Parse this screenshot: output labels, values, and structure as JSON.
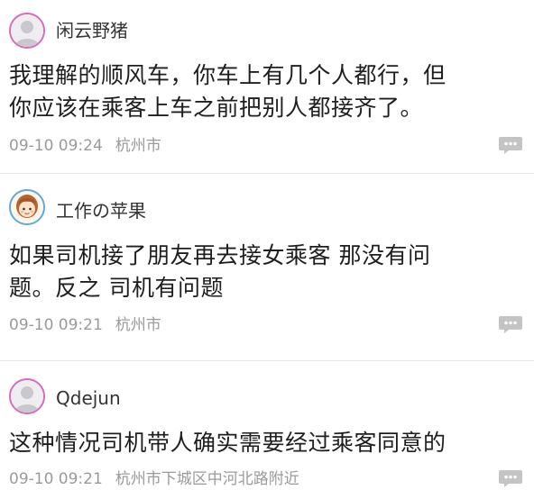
{
  "comments": [
    {
      "username": "闲云野猪",
      "line1": "我理解的顺风车，你车上有几个人都行，但",
      "line2": "你应该在乘客上车之前把别人都接齐了。",
      "time": "09-10 09:24",
      "location": "杭州市",
      "avatar_icon": "default-avatar-icon"
    },
    {
      "username": "工作の苹果",
      "line1": "如果司机接了朋友再去接女乘客 那没有问",
      "line2": "题。反之 司机有问题",
      "time": "09-10 09:21",
      "location": "杭州市",
      "avatar_icon": "cartoon-girl-avatar-icon"
    },
    {
      "username": "Qdejun",
      "line1": "这种情况司机带人确实需要经过乘客同意的",
      "time": "09-10 09:21",
      "location": "杭州市下城区中河北路附近",
      "avatar_icon": "default-avatar-icon"
    }
  ],
  "colors": {
    "avatar_ring": "#d86bb8",
    "photo_ring": "#5aa9dd",
    "meta_text": "#9a9a9a",
    "reply_icon": "#c4c4c4"
  }
}
